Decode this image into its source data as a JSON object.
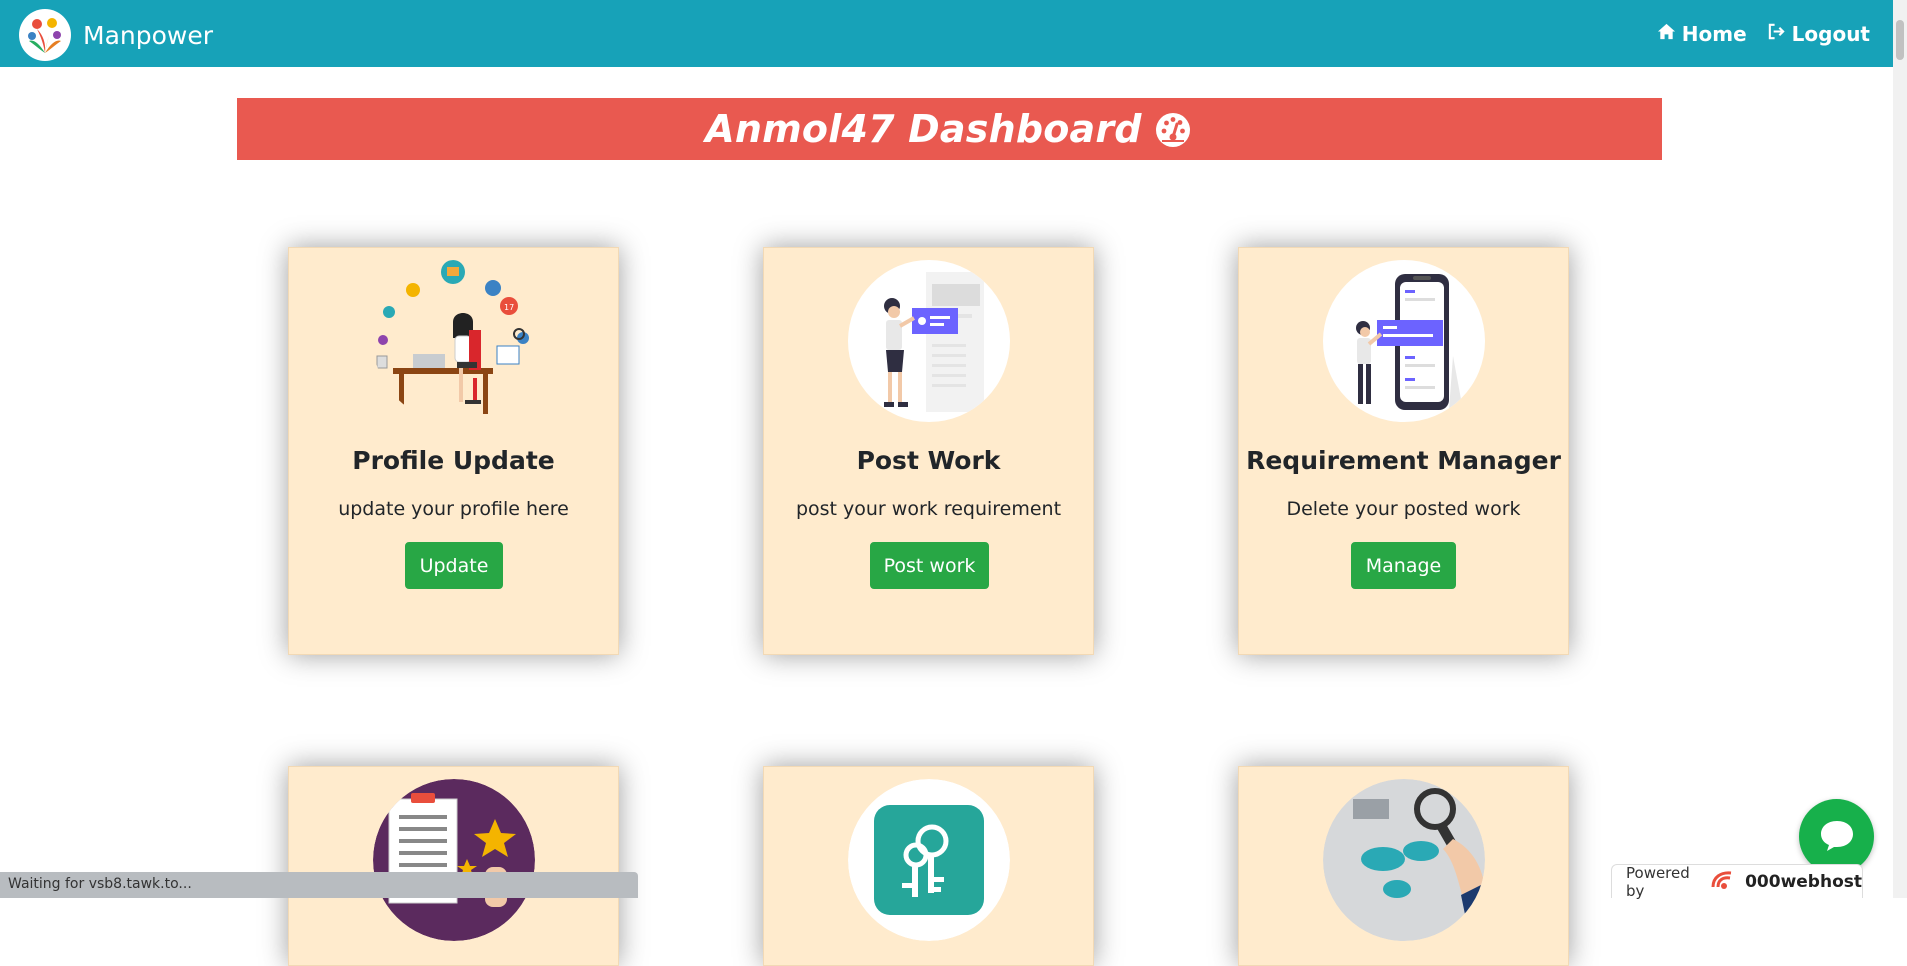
{
  "navbar": {
    "brand": "Manpower",
    "links": [
      {
        "label": "Home",
        "icon": "home-icon"
      },
      {
        "label": "Logout",
        "icon": "logout-icon"
      }
    ],
    "background": "#17a2b8"
  },
  "banner": {
    "title": "Anmol47 Dashboard",
    "icon": "tachometer-icon",
    "background": "#e95950"
  },
  "cards": [
    {
      "title": "Profile Update",
      "description": "update your profile here",
      "button": "Update",
      "illustration": "profile-illustration"
    },
    {
      "title": "Post Work",
      "description": "post your work requirement",
      "button": "Post work",
      "illustration": "post-work-illustration"
    },
    {
      "title": "Requirement Manager",
      "description": "Delete your posted work",
      "button": "Manage",
      "illustration": "requirement-illustration"
    },
    {
      "illustration": "review-illustration"
    },
    {
      "illustration": "keys-illustration"
    },
    {
      "illustration": "world-search-illustration"
    }
  ],
  "status_bar": {
    "text": "Waiting for vsb8.tawk.to..."
  },
  "powered_by": {
    "label": "Powered by",
    "host": "000webhost"
  },
  "colors": {
    "card_bg": "#ffebcd",
    "button": "#28a745",
    "chat": "#17b04b"
  }
}
